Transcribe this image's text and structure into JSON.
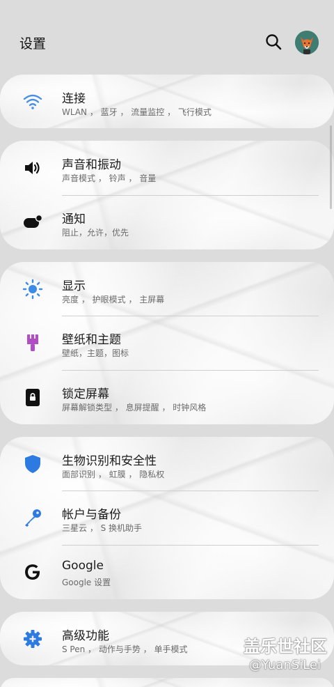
{
  "header": {
    "title": "设置",
    "search_icon": "search-icon",
    "avatar_icon": "fox-avatar"
  },
  "colors": {
    "wifi": "#4a90e2",
    "sound": "#111111",
    "notify": "#111111",
    "display": "#3c8be6",
    "wallpaper": "#b04ec4",
    "lock": "#111111",
    "biometric": "#2d7be0",
    "account": "#2d7be0",
    "google": "#111111",
    "advanced": "#2d7be0"
  },
  "groups": [
    {
      "items": [
        {
          "title": "连接",
          "subtitle": "WLAN ， 蓝牙 ， 流量监控 ， 飞行模式",
          "icon": "wifi-icon"
        }
      ]
    },
    {
      "items": [
        {
          "title": "声音和振动",
          "subtitle": "声音模式 ， 铃声 ， 音量",
          "icon": "speaker-icon"
        },
        {
          "title": "通知",
          "subtitle": "阻止，允许，优先",
          "icon": "notification-icon"
        }
      ]
    },
    {
      "items": [
        {
          "title": "显示",
          "subtitle": "亮度 ， 护眼模式 ， 主屏幕",
          "icon": "brightness-icon"
        },
        {
          "title": "壁纸和主题",
          "subtitle": "壁纸，主题，图标",
          "icon": "brush-icon"
        },
        {
          "title": "锁定屏幕",
          "subtitle": "屏幕解锁类型 ， 息屏提醒 ， 时钟风格",
          "icon": "lock-icon"
        }
      ]
    },
    {
      "items": [
        {
          "title": "生物识别和安全性",
          "subtitle": "面部识别 ， 虹膜 ， 隐私权",
          "icon": "shield-icon"
        },
        {
          "title": "帐户与备份",
          "subtitle": "三星云 ， S 换机助手",
          "icon": "key-icon"
        },
        {
          "title": "Google",
          "subtitle": "Google 设置",
          "icon": "google-icon"
        }
      ]
    },
    {
      "items": [
        {
          "title": "高级功能",
          "subtitle": "S Pen ， 动作与手势 ， 单手模式",
          "icon": "gear-plus-icon"
        }
      ]
    }
  ],
  "watermark": {
    "line1": "盖乐世社区",
    "line2": "@YuanSiLei"
  }
}
